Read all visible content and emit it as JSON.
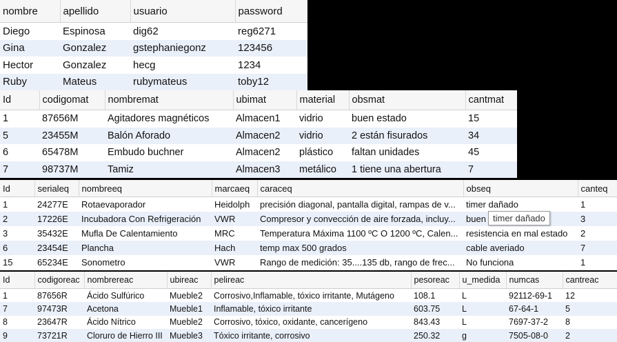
{
  "usuarios": {
    "headers": [
      "nombre",
      "apellido",
      "usuario",
      "password"
    ],
    "rows": [
      [
        "Diego",
        "Espinosa",
        "dig62",
        "reg6271"
      ],
      [
        "Gina",
        "Gonzalez",
        "gstephaniegonz",
        "123456"
      ],
      [
        "Hector",
        "Gonzalez",
        "hecg",
        "1234"
      ],
      [
        "Ruby",
        "Mateus",
        "rubymateus",
        "toby12"
      ]
    ]
  },
  "materiales": {
    "headers": [
      "Id",
      "codigomat",
      "nombremat",
      "ubimat",
      "material",
      "obsmat",
      "cantmat"
    ],
    "rows": [
      [
        "1",
        "87656M",
        "Agitadores magnéticos",
        "Almacen1",
        "vidrio",
        "buen estado",
        "15"
      ],
      [
        "5",
        "23455M",
        "Balón Aforado",
        "Almacen2",
        "vidrio",
        "2 están fisurados",
        "34"
      ],
      [
        "6",
        "65478M",
        "Embudo buchner",
        "Almacen2",
        "plástico",
        "faltan unidades",
        "45"
      ],
      [
        "7",
        "98737M",
        "Tamiz",
        "Almacen3",
        "metálico",
        "1 tiene una abertura",
        "7"
      ]
    ]
  },
  "equipos": {
    "headers": [
      "Id",
      "serialeq",
      "nombreeq",
      "marcaeq",
      "caraceq",
      "obseq",
      "canteq"
    ],
    "rows": [
      [
        "1",
        "24277E",
        "Rotaevaporador",
        "Heidolph",
        "precisión diagonal, pantalla digital, rampas de v...",
        "timer dañado",
        "1"
      ],
      [
        "2",
        "17226E",
        "Incubadora Con Refrigeración",
        "VWR",
        "Compresor y convección de aire forzada, incluy...",
        "buen",
        "3"
      ],
      [
        "3",
        "35432E",
        "Mufla De Calentamiento",
        "MRC",
        "Temperatura Máxima 1100 ºC O 1200 ºC, Calen...",
        "resistencia en mal estado",
        "2"
      ],
      [
        "6",
        "23454E",
        "Plancha",
        "Hach",
        "temp max 500 grados",
        "cable averiado",
        "7"
      ],
      [
        "15",
        "65234E",
        "Sonometro",
        "VWR",
        "Rango de medición: 35....135 db, rango de frec...",
        "No funciona",
        "1"
      ]
    ],
    "tooltip": "timer dañado"
  },
  "reactivos": {
    "headers": [
      "Id",
      "codigoreac",
      "nombrereac",
      "ubireac",
      "pelireac",
      "pesoreac",
      "u_medida",
      "numcas",
      "cantreac"
    ],
    "rows": [
      [
        "1",
        "87656R",
        "Ácido Sulfúrico",
        "Mueble2",
        "Corrosivo,Inflamable, tóxico irritante, Mutágeno",
        "108.1",
        "L",
        "92112-69-1",
        "12"
      ],
      [
        "7",
        "97473R",
        "Acetona",
        "Mueble1",
        "Inflamable, tóxico irritante",
        "603.75",
        "L",
        "67-64-1",
        "5"
      ],
      [
        "8",
        "23647R",
        "Ácido Nítrico",
        "Mueble2",
        "Corrosivo, tóxico, oxidante, cancerígeno",
        "843.43",
        "L",
        "7697-37-2",
        "8"
      ],
      [
        "9",
        "73721R",
        "Cloruro de Hierro III",
        "Mueble3",
        "Tóxico irritante, corrosivo",
        "250.32",
        "g",
        "7505-08-0",
        "2"
      ]
    ]
  }
}
